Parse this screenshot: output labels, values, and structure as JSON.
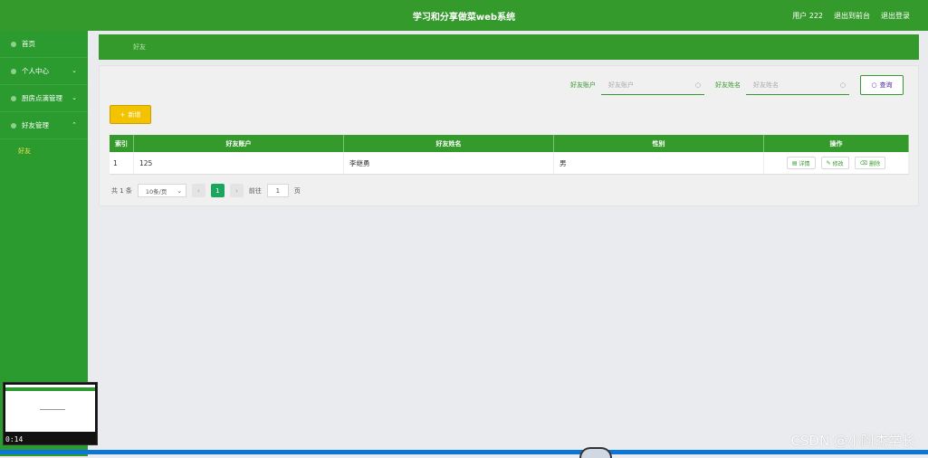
{
  "header": {
    "title": "学习和分享做菜web系统",
    "user": "用户 222",
    "back_to_front": "退出到前台",
    "logout": "退出登录"
  },
  "sidebar": {
    "items": [
      {
        "label": "首页"
      },
      {
        "label": "个人中心",
        "chevron": "⌄"
      },
      {
        "label": "厨房点滴管理",
        "chevron": "⌄"
      },
      {
        "label": "好友管理",
        "chevron": "⌃"
      }
    ],
    "subitems": [
      {
        "label": "好友"
      }
    ]
  },
  "breadcrumb": {
    "label": "好友"
  },
  "search": {
    "account_label": "好友账户",
    "account_placeholder": "好友账户",
    "name_label": "好友姓名",
    "name_placeholder": "好友姓名",
    "query_label": "查询"
  },
  "toolbar": {
    "add_label": "新增"
  },
  "table": {
    "headers": [
      "索引",
      "好友账户",
      "好友姓名",
      "性别",
      "操作"
    ],
    "rows": [
      {
        "index": "1",
        "account": "125",
        "name": "李继勇",
        "gender": "男",
        "actions": {
          "detail": "详情",
          "edit": "修改",
          "delete": "删除"
        }
      }
    ]
  },
  "pagination": {
    "total": "共 1 条",
    "page_size": "10条/页",
    "current": "1",
    "goto_prefix": "前往",
    "goto_value": "1",
    "goto_suffix": "页"
  },
  "video": {
    "time": "0:14"
  },
  "watermark": "CSDN @小阿杰学长",
  "colors": {
    "primary": "#349a2b",
    "add_button": "#f4c300",
    "active_page": "#1aa65c",
    "progress": "#0b75d8"
  }
}
